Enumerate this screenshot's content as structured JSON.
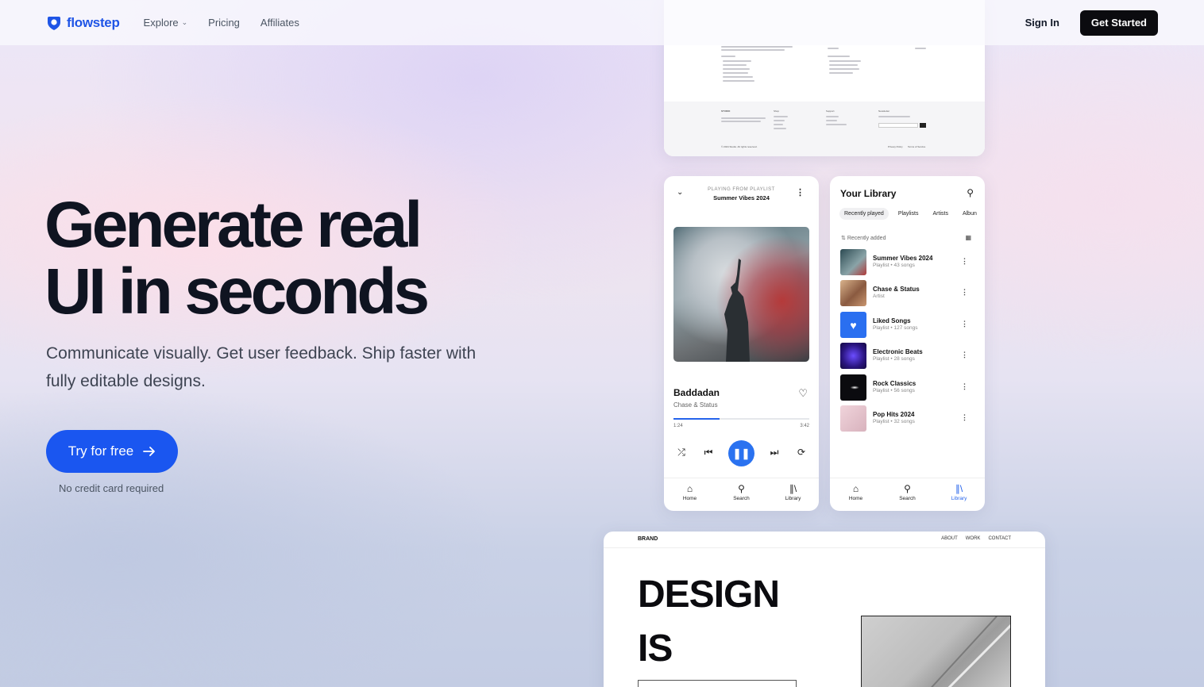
{
  "nav": {
    "logo": "flowstep",
    "links": [
      "Explore",
      "Pricing",
      "Affiliates"
    ],
    "sign_in": "Sign In",
    "get_started": "Get Started"
  },
  "hero": {
    "title_line1": "Generate real",
    "title_line2": "UI in seconds",
    "subtitle": "Communicate visually. Get user feedback. Ship faster with fully editable designs.",
    "cta": "Try for free",
    "note": "No credit card required"
  },
  "colors": {
    "brand": "#1f55e6",
    "cta": "#1a56f0",
    "dark_button": "#0b0b0f",
    "player_accent": "#2a72f0"
  },
  "player": {
    "from_label": "PLAYING FROM PLAYLIST",
    "playlist": "Summer Vibes 2024",
    "song": "Baddadan",
    "artist": "Chase & Status",
    "time_current": "1:24",
    "time_total": "3:42",
    "progress": 0.34,
    "tabs": [
      "Home",
      "Search",
      "Library"
    ]
  },
  "library": {
    "title": "Your Library",
    "chips": [
      "Recently played",
      "Playlists",
      "Artists",
      "Albun"
    ],
    "sort_label": "Recently added",
    "items": [
      {
        "name": "Summer Vibes 2024",
        "meta": "Playlist • 43 songs",
        "color": "#4a7b80"
      },
      {
        "name": "Chase & Status",
        "meta": "Artist",
        "color": "#b98a6a"
      },
      {
        "name": "Liked Songs",
        "meta": "Playlist • 127 songs",
        "color": "#2a6ff0"
      },
      {
        "name": "Electronic Beats",
        "meta": "Playlist • 28 songs",
        "color": "#3a1f9e"
      },
      {
        "name": "Rock Classics",
        "meta": "Playlist • 56 songs",
        "color": "#0b0b0f"
      },
      {
        "name": "Pop Hits 2024",
        "meta": "Playlist • 32 songs",
        "color": "#e7c6cf"
      }
    ],
    "tabs": [
      "Home",
      "Search",
      "Library"
    ]
  },
  "footer_preview": {
    "brand": "STUDIO",
    "cols": [
      "Shop",
      "Support",
      "Newsletter"
    ],
    "copyright": "© 2024 Studio. All rights reserved.",
    "legal": [
      "Privacy Policy",
      "Terms of Service"
    ]
  },
  "design_preview": {
    "brand": "BRAND",
    "nav": [
      "ABOUT",
      "WORK",
      "CONTACT"
    ],
    "word1": "DESIGN",
    "word2": "IS"
  }
}
